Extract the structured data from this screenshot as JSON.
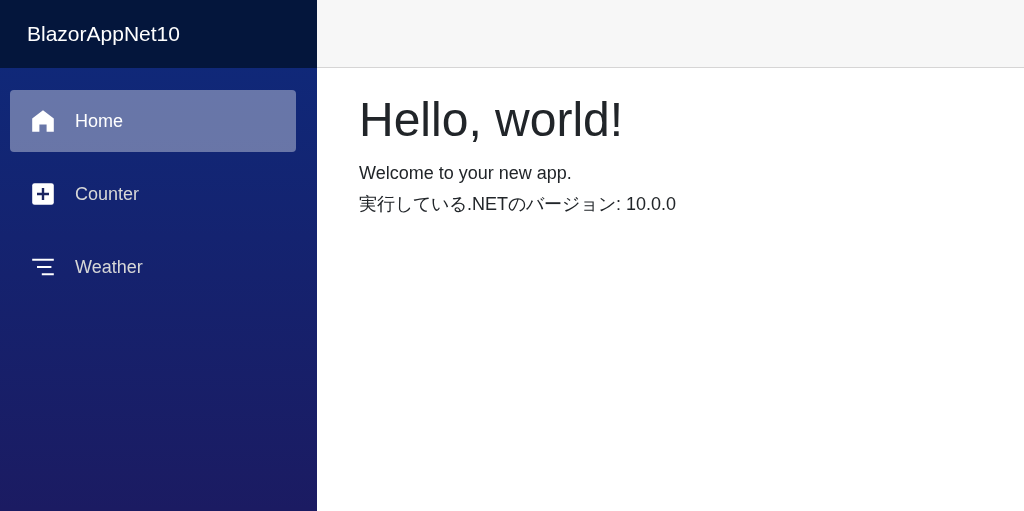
{
  "brand": "BlazorAppNet10",
  "nav": [
    {
      "label": "Home",
      "kind": "home",
      "selected": true
    },
    {
      "label": "Counter",
      "kind": "plus",
      "selected": false
    },
    {
      "label": "Weather",
      "kind": "list",
      "selected": false
    }
  ],
  "content": {
    "title": "Hello, world!",
    "paragraphs": [
      "Welcome to your new app.",
      "実行している.NETのバージョン: 10.0.0"
    ]
  }
}
